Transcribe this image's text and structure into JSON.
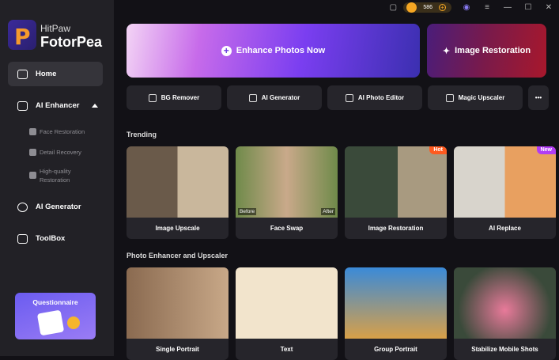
{
  "app": {
    "brand_top": "HitPaw",
    "brand_name": "FotorPea"
  },
  "topbar": {
    "coins": "586"
  },
  "sidebar": {
    "items": [
      {
        "label": "Home",
        "icon": "home-icon"
      },
      {
        "label": "AI Enhancer",
        "icon": "ai-enhancer-icon"
      },
      {
        "label": "AI Generator",
        "icon": "ai-generator-icon"
      },
      {
        "label": "ToolBox",
        "icon": "toolbox-icon"
      }
    ],
    "sub_items": [
      {
        "label": "Face Restoration"
      },
      {
        "label": "Detail Recovery"
      },
      {
        "label": "High-quality Restoration"
      }
    ],
    "questionnaire": "Questionnaire"
  },
  "hero": {
    "enhance": "Enhance Photos Now",
    "restore": "Image Restoration"
  },
  "tools": [
    {
      "label": "BG Remover"
    },
    {
      "label": "AI Generator"
    },
    {
      "label": "AI Photo Editor"
    },
    {
      "label": "Magic Upscaler"
    }
  ],
  "more": "•••",
  "trending": {
    "title": "Trending",
    "cards": [
      {
        "label": "Image Upscale"
      },
      {
        "label": "Face Swap",
        "before": "Before",
        "after": "After"
      },
      {
        "label": "Image Restoration",
        "badge": "Hot"
      },
      {
        "label": "AI Replace",
        "badge": "New"
      }
    ]
  },
  "enhancer": {
    "title": "Photo Enhancer and Upscaler",
    "cards": [
      {
        "label": "Single Portrait"
      },
      {
        "label": "Text"
      },
      {
        "label": "Group Portrait"
      },
      {
        "label": "Stabilize Mobile Shots"
      }
    ]
  },
  "colors": {
    "hot": "#ff5a1f",
    "new": "#b13cf5",
    "accent": "#7a3ef0"
  }
}
